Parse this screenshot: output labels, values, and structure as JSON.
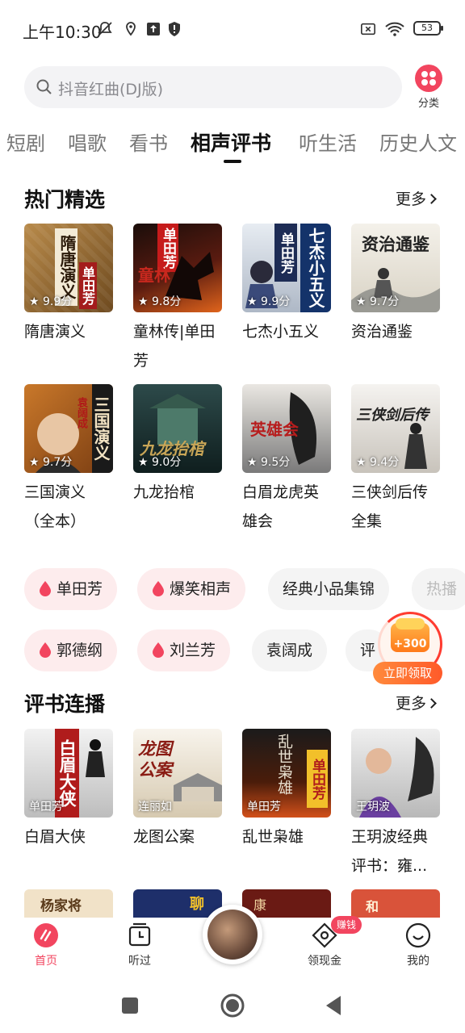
{
  "status_bar": {
    "time": "上午10:30",
    "battery": "53"
  },
  "search": {
    "placeholder": "抖音红曲(DJ版)",
    "category_label": "分类"
  },
  "tabs": [
    "短剧",
    "唱歌",
    "看书",
    "相声评书",
    "听生活",
    "历史人文"
  ],
  "active_tab": "相声评书",
  "hot_section": {
    "title": "热门精选",
    "more": "更多",
    "items": [
      {
        "name": "隋唐演义",
        "rating": "9.9分",
        "cover_text": "隋唐演义",
        "tag": "单田芳"
      },
      {
        "name": "童林传|单田芳",
        "rating": "9.8分",
        "cover_text": "童林",
        "tag": "单田芳"
      },
      {
        "name": "七杰小五义",
        "rating": "9.9分",
        "cover_text": "七杰小五义",
        "tag": "单田芳"
      },
      {
        "name": "资治通鉴",
        "rating": "9.7分",
        "cover_text": "资治通鉴",
        "tag": ""
      },
      {
        "name": "三国演义（全本）",
        "rating": "9.7分",
        "cover_text": "三国演义",
        "tag": "袁阔成"
      },
      {
        "name": "九龙抬棺",
        "rating": "9.0分",
        "cover_text": "九龙抬棺",
        "tag": ""
      },
      {
        "name": "白眉龙虎英雄会",
        "rating": "9.5分",
        "cover_text": "英雄会",
        "tag": ""
      },
      {
        "name": "三侠剑后传全集",
        "rating": "9.4分",
        "cover_text": "三侠剑后传",
        "tag": ""
      }
    ]
  },
  "chips_row1": [
    "单田芳",
    "爆笑相声",
    "经典小品集锦",
    "热播"
  ],
  "chips_row2": [
    "郭德纲",
    "刘兰芳",
    "袁阔成",
    "评"
  ],
  "reward": {
    "amount": "+300",
    "claim": "立即领取"
  },
  "serial_section": {
    "title": "评书连播",
    "more": "更多",
    "items": [
      {
        "name": "白眉大侠",
        "author": "单田芳",
        "cover_text": "白眉大侠"
      },
      {
        "name": "龙图公案",
        "author": "连丽如",
        "cover_text": "龙图公案"
      },
      {
        "name": "乱世枭雄",
        "author": "单田芳",
        "cover_text": "乱世枭雄"
      },
      {
        "name": "王玥波经典评书：雍...",
        "author": "王玥波",
        "cover_text": ""
      }
    ]
  },
  "partial_row": [
    "杨家将",
    "聊",
    "康",
    "和"
  ],
  "bottom_nav": [
    {
      "label": "首页",
      "icon": "home-icon"
    },
    {
      "label": "听过",
      "icon": "history-icon"
    },
    {
      "label": "",
      "icon": "player-disc"
    },
    {
      "label": "领现金",
      "icon": "cash-icon",
      "badge": "赚钱"
    },
    {
      "label": "我的",
      "icon": "profile-icon"
    }
  ],
  "colors": {
    "accent": "#f2455f",
    "chip_hot_bg": "#fdeced",
    "chip_plain_bg": "#f4f4f4"
  }
}
